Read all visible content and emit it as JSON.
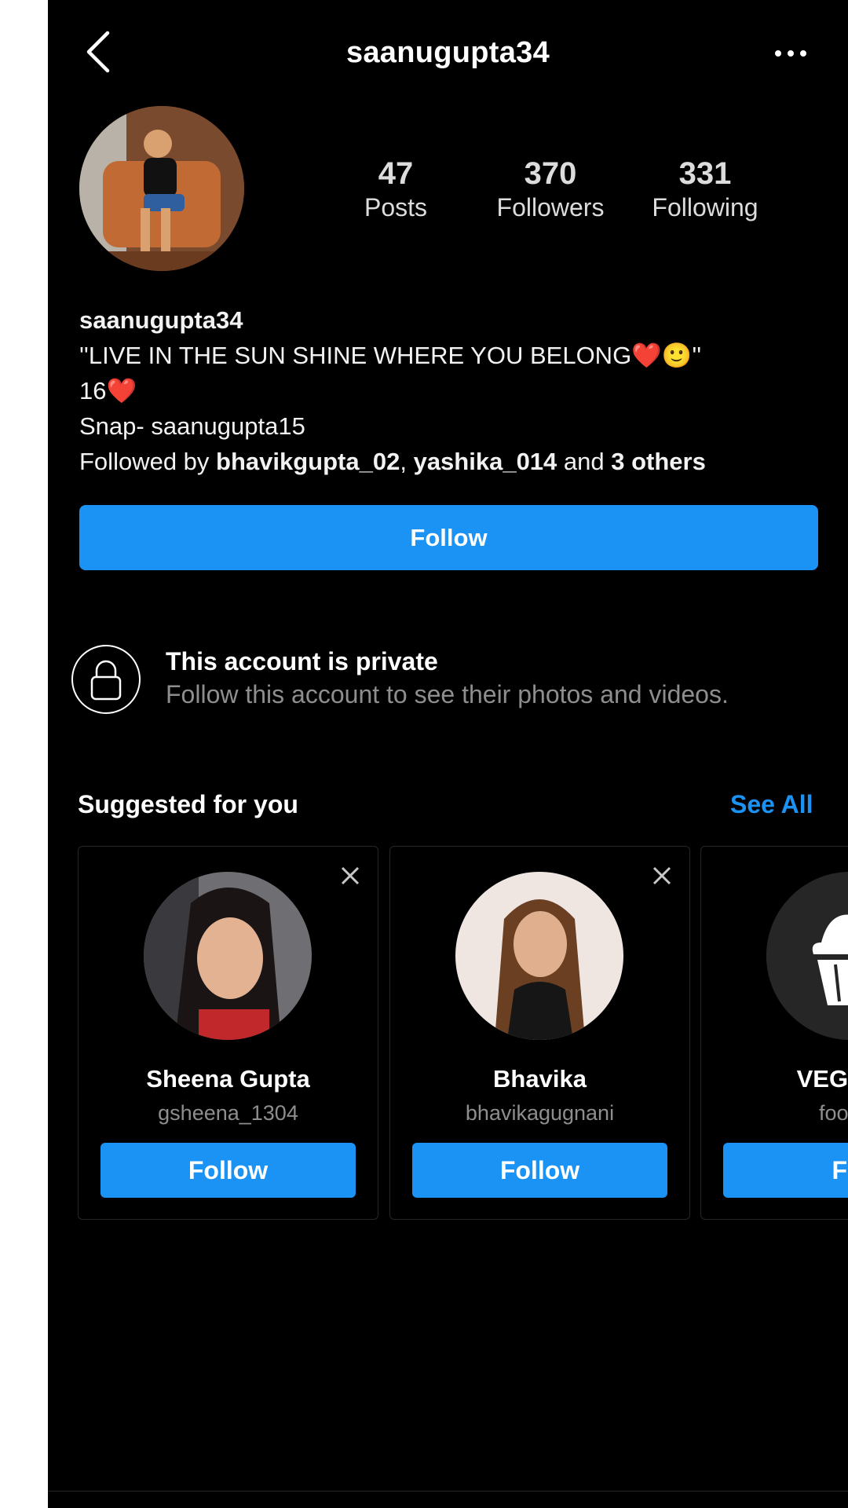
{
  "header": {
    "title": "saanugupta34",
    "back_icon": "chevron-left-icon",
    "more_icon": "more-horizontal-icon"
  },
  "profile": {
    "stats": [
      {
        "value": "47",
        "label": "Posts"
      },
      {
        "value": "370",
        "label": "Followers"
      },
      {
        "value": "331",
        "label": "Following"
      }
    ],
    "username": "saanugupta34",
    "bio_line1": "''LIVE IN THE SUN SHINE WHERE YOU BELONG❤️🙂''",
    "bio_line2": "16❤️",
    "bio_line3": "Snap- saanugupta15",
    "followed_prefix": "Followed by ",
    "followed_user1": "bhavikgupta_02",
    "followed_sep": ", ",
    "followed_user2": "yashika_014",
    "followed_and": " and ",
    "followed_others": "3 others",
    "follow_label": "Follow"
  },
  "private_notice": {
    "title": "This account is private",
    "subtitle": "Follow this account to see their photos and videos."
  },
  "suggested": {
    "title": "Suggested for you",
    "see_all": "See All",
    "cards": [
      {
        "name": "Sheena Gupta",
        "handle": "gsheena_1304",
        "button": "Follow"
      },
      {
        "name": "Bhavika",
        "handle": "bhavikagugnani",
        "button": "Follow"
      },
      {
        "name": "VEGAN F",
        "handle": "food.ie",
        "button": "Fol"
      }
    ]
  },
  "colors": {
    "background": "#000000",
    "accent": "#1a93f5",
    "secondary_text": "#8e8e8e"
  }
}
